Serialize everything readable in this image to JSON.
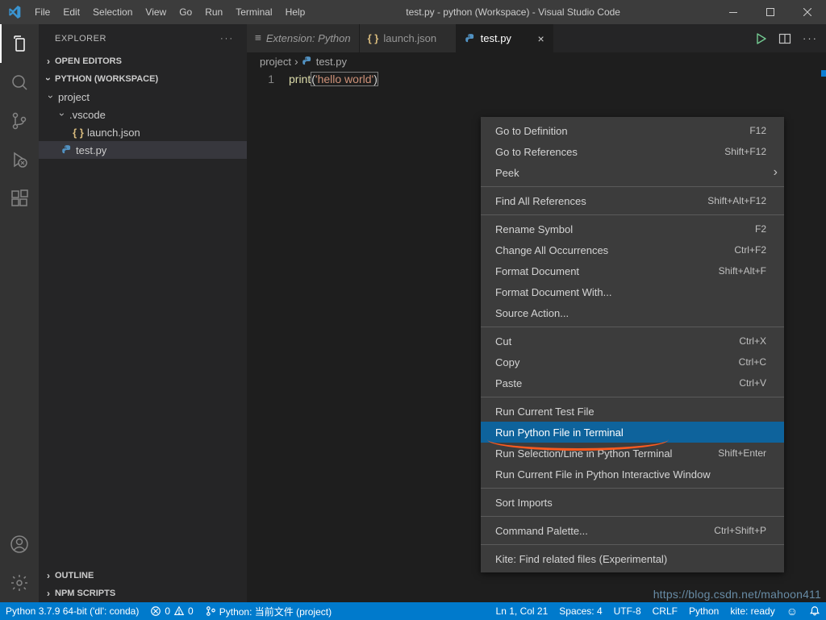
{
  "title": "test.py - python (Workspace) - Visual Studio Code",
  "menus": [
    "File",
    "Edit",
    "Selection",
    "View",
    "Go",
    "Run",
    "Terminal",
    "Help"
  ],
  "explorer": {
    "title": "EXPLORER",
    "sections": {
      "openEditors": "OPEN EDITORS",
      "workspace": "PYTHON (WORKSPACE)",
      "outline": "OUTLINE",
      "npm": "NPM SCRIPTS"
    },
    "tree": {
      "project": "project",
      "vscode": ".vscode",
      "launch": "launch.json",
      "testpy": "test.py"
    }
  },
  "tabs": {
    "ext": "Extension: Python",
    "launch": "launch.json",
    "testpy": "test.py"
  },
  "breadcrumbs": {
    "a": "project",
    "b": "test.py"
  },
  "code": {
    "lineNo": "1",
    "fn": "print",
    "open": "(",
    "str": "'hello world'",
    "close": ")"
  },
  "context": {
    "items": [
      {
        "label": "Go to Definition",
        "kb": "F12"
      },
      {
        "label": "Go to References",
        "kb": "Shift+F12"
      },
      {
        "label": "Peek",
        "sub": true
      },
      "sep",
      {
        "label": "Find All References",
        "kb": "Shift+Alt+F12"
      },
      "sep",
      {
        "label": "Rename Symbol",
        "kb": "F2"
      },
      {
        "label": "Change All Occurrences",
        "kb": "Ctrl+F2"
      },
      {
        "label": "Format Document",
        "kb": "Shift+Alt+F"
      },
      {
        "label": "Format Document With..."
      },
      {
        "label": "Source Action..."
      },
      "sep",
      {
        "label": "Cut",
        "kb": "Ctrl+X"
      },
      {
        "label": "Copy",
        "kb": "Ctrl+C"
      },
      {
        "label": "Paste",
        "kb": "Ctrl+V"
      },
      "sep",
      {
        "label": "Run Current Test File"
      },
      {
        "label": "Run Python File in Terminal",
        "sel": true
      },
      {
        "label": "Run Selection/Line in Python Terminal",
        "kb": "Shift+Enter"
      },
      {
        "label": "Run Current File in Python Interactive Window"
      },
      "sep",
      {
        "label": "Sort Imports"
      },
      "sep",
      {
        "label": "Command Palette...",
        "kb": "Ctrl+Shift+P"
      },
      "sep",
      {
        "label": "Kite: Find related files (Experimental)"
      }
    ]
  },
  "status": {
    "python": "Python 3.7.9 64-bit ('dl': conda)",
    "errors": "0",
    "warnings": "0",
    "interp": "Python: 当前文件 (project)",
    "lncol": "Ln 1, Col 21",
    "spaces": "Spaces: 4",
    "enc": "UTF-8",
    "eol": "CRLF",
    "lang": "Python",
    "kite": "kite: ready",
    "feedbackIcon": "☺",
    "bellIcon": "🔔"
  },
  "watermark": "https://blog.csdn.net/mahoon411"
}
